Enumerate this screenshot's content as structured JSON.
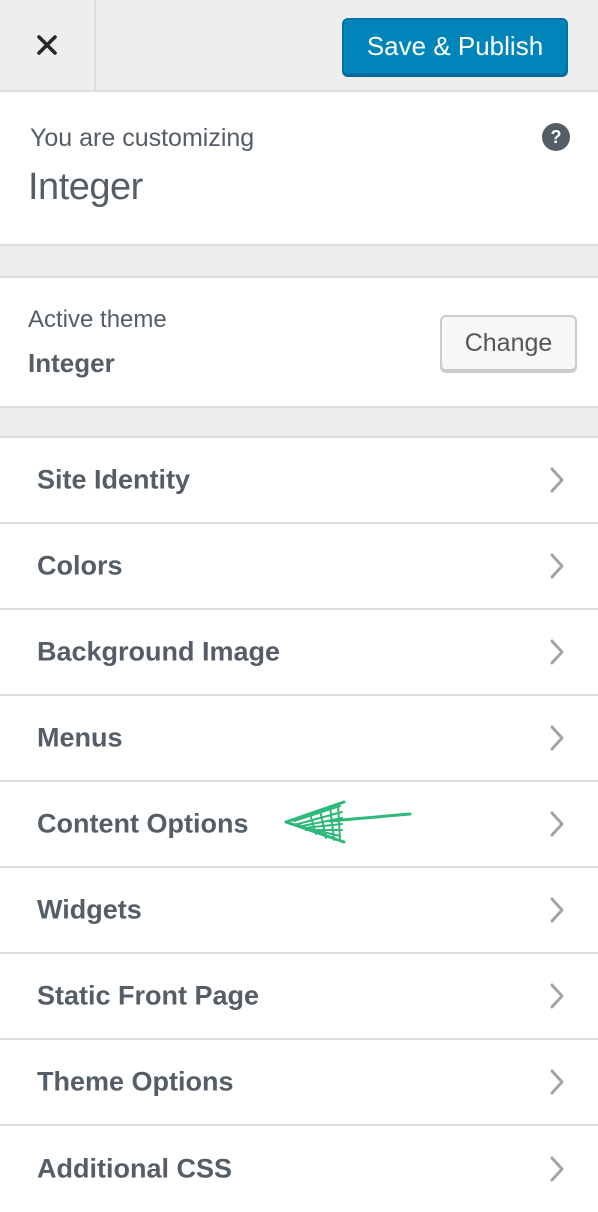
{
  "header": {
    "close_icon": "close-icon",
    "publish_label": "Save & Publish",
    "publish_color": "#0085ba"
  },
  "info": {
    "label": "You are customizing",
    "title": "Integer",
    "help_icon": "help-icon"
  },
  "theme": {
    "label": "Active theme",
    "name": "Integer",
    "change_label": "Change"
  },
  "sections": [
    {
      "label": "Site Identity"
    },
    {
      "label": "Colors"
    },
    {
      "label": "Background Image"
    },
    {
      "label": "Menus"
    },
    {
      "label": "Content Options"
    },
    {
      "label": "Widgets"
    },
    {
      "label": "Static Front Page"
    },
    {
      "label": "Theme Options"
    },
    {
      "label": "Additional CSS"
    }
  ],
  "annotation": {
    "icon": "hand-drawn-arrow-icon",
    "color": "#2eb87a"
  }
}
